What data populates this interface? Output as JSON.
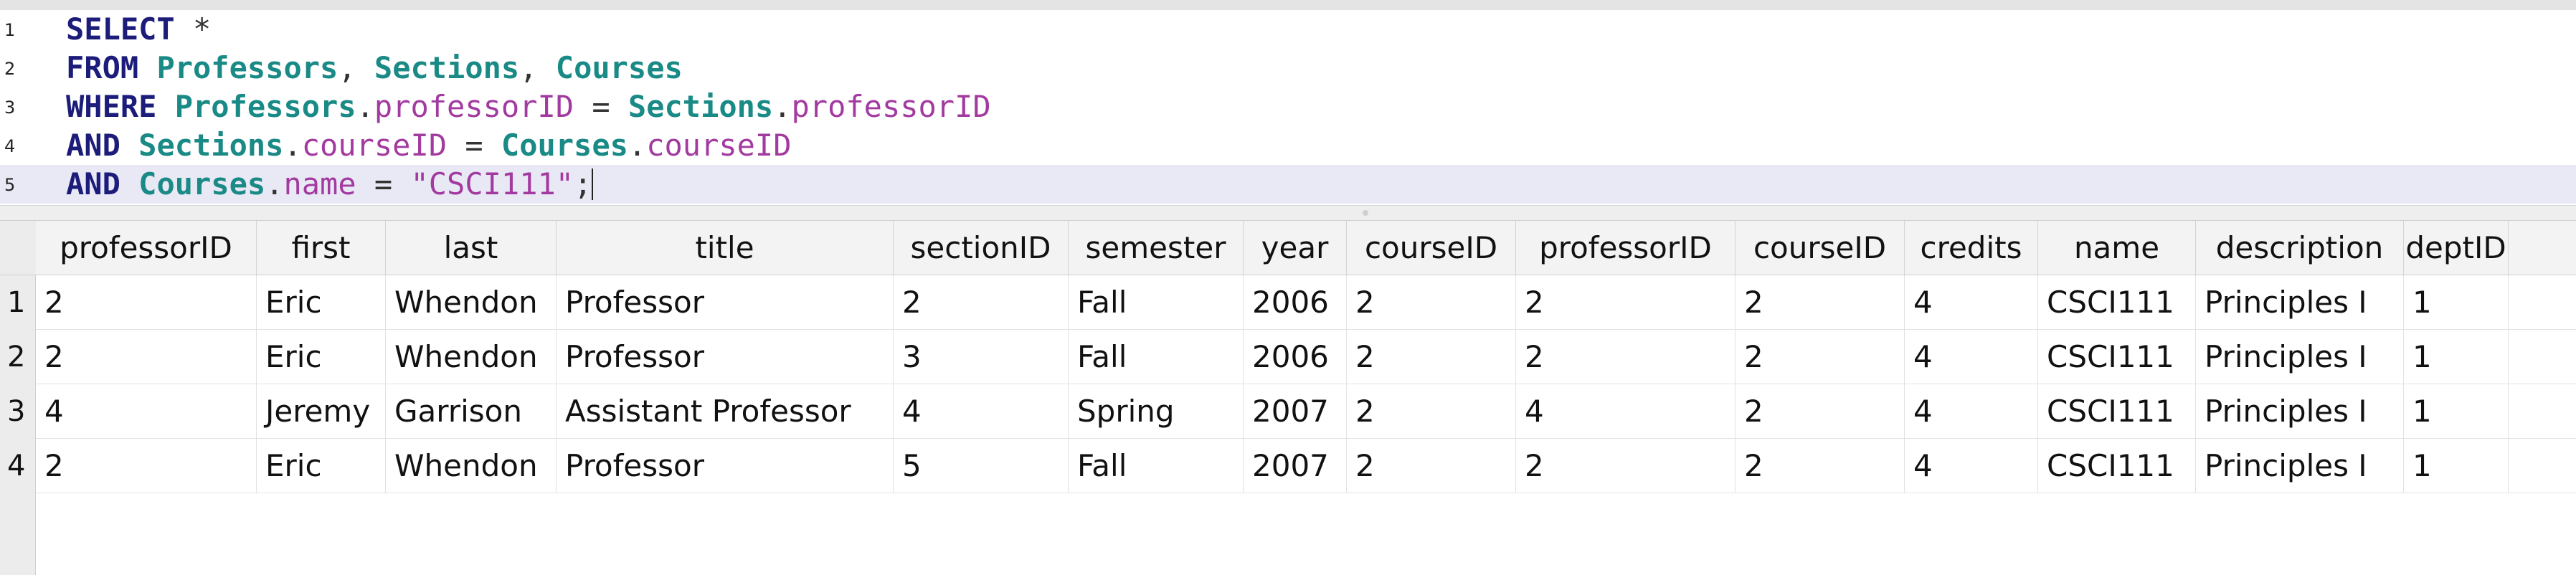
{
  "editor": {
    "lines": [
      {
        "num": "1",
        "tokens": [
          {
            "t": "kw",
            "v": "SELECT"
          },
          {
            "t": "op",
            "v": " *"
          }
        ]
      },
      {
        "num": "2",
        "tokens": [
          {
            "t": "kw",
            "v": "FROM"
          },
          {
            "t": "op",
            "v": " "
          },
          {
            "t": "tbl",
            "v": "Professors"
          },
          {
            "t": "op",
            "v": ", "
          },
          {
            "t": "tbl",
            "v": "Sections"
          },
          {
            "t": "op",
            "v": ", "
          },
          {
            "t": "tbl",
            "v": "Courses"
          }
        ]
      },
      {
        "num": "3",
        "tokens": [
          {
            "t": "kw",
            "v": "WHERE"
          },
          {
            "t": "op",
            "v": " "
          },
          {
            "t": "tbl",
            "v": "Professors"
          },
          {
            "t": "op",
            "v": "."
          },
          {
            "t": "col",
            "v": "professorID"
          },
          {
            "t": "op",
            "v": " = "
          },
          {
            "t": "tbl",
            "v": "Sections"
          },
          {
            "t": "op",
            "v": "."
          },
          {
            "t": "col",
            "v": "professorID"
          }
        ]
      },
      {
        "num": "4",
        "tokens": [
          {
            "t": "kw",
            "v": "AND"
          },
          {
            "t": "op",
            "v": " "
          },
          {
            "t": "tbl",
            "v": "Sections"
          },
          {
            "t": "op",
            "v": "."
          },
          {
            "t": "col",
            "v": "courseID"
          },
          {
            "t": "op",
            "v": " = "
          },
          {
            "t": "tbl",
            "v": "Courses"
          },
          {
            "t": "op",
            "v": "."
          },
          {
            "t": "col",
            "v": "courseID"
          }
        ]
      },
      {
        "num": "5",
        "tokens": [
          {
            "t": "kw",
            "v": "AND"
          },
          {
            "t": "op",
            "v": " "
          },
          {
            "t": "tbl",
            "v": "Courses"
          },
          {
            "t": "op",
            "v": "."
          },
          {
            "t": "col",
            "v": "name"
          },
          {
            "t": "op",
            "v": " = "
          },
          {
            "t": "str",
            "v": "\"CSCI111\""
          },
          {
            "t": "op",
            "v": ";"
          }
        ]
      }
    ],
    "current_line": 5
  },
  "results": {
    "columns": [
      "professorID",
      "first",
      "last",
      "title",
      "sectionID",
      "semester",
      "year",
      "courseID",
      "professorID",
      "courseID",
      "credits",
      "name",
      "description",
      "deptID"
    ],
    "rows": [
      {
        "num": "1",
        "cells": [
          "2",
          "Eric",
          "Whendon",
          "Professor",
          "2",
          "Fall",
          "2006",
          "2",
          "2",
          "2",
          "4",
          "CSCI111",
          "Principles I",
          "1"
        ]
      },
      {
        "num": "2",
        "cells": [
          "2",
          "Eric",
          "Whendon",
          "Professor",
          "3",
          "Fall",
          "2006",
          "2",
          "2",
          "2",
          "4",
          "CSCI111",
          "Principles I",
          "1"
        ]
      },
      {
        "num": "3",
        "cells": [
          "4",
          "Jeremy",
          "Garrison",
          "Assistant Professor",
          "4",
          "Spring",
          "2007",
          "2",
          "4",
          "2",
          "4",
          "CSCI111",
          "Principles I",
          "1"
        ]
      },
      {
        "num": "4",
        "cells": [
          "2",
          "Eric",
          "Whendon",
          "Professor",
          "5",
          "Fall",
          "2007",
          "2",
          "2",
          "2",
          "4",
          "CSCI111",
          "Principles I",
          "1"
        ]
      }
    ]
  },
  "colors": {
    "keyword": "#1c1c7a",
    "table": "#1a8a86",
    "column": "#a23aa0",
    "current_line_bg": "#e9e9f6"
  }
}
